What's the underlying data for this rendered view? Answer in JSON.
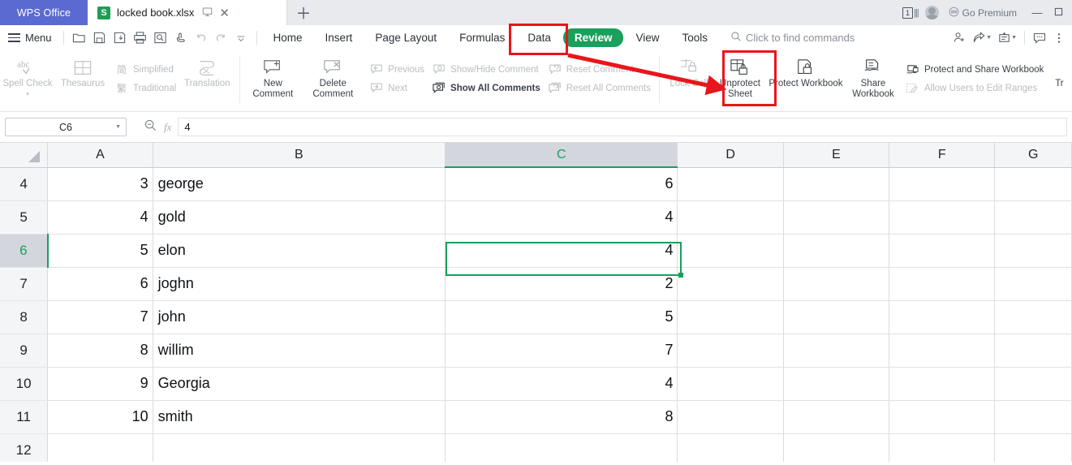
{
  "titlebar": {
    "app_tab": "WPS Office",
    "doc_tab": {
      "icon": "xlsx-icon",
      "name": "locked book.xlsx",
      "present_icon": "present-icon",
      "close_icon": "close-icon"
    },
    "new_tab_icon": "plus-icon",
    "count_badge": "1",
    "avatar": "user-avatar",
    "premium_label": "Go Premium",
    "premium_icon": "crown-icon",
    "minimize": "—",
    "maximize": "□"
  },
  "menurow": {
    "menu_label": "Menu",
    "quick_icons": [
      "open-folder-icon",
      "save-icon",
      "save-as-icon",
      "print-icon",
      "print-preview-icon",
      "touch-mode-icon",
      "undo-icon",
      "redo-icon",
      "customize-chevron-icon"
    ],
    "tabs": [
      {
        "label": "Home",
        "active": false
      },
      {
        "label": "Insert",
        "active": false
      },
      {
        "label": "Page Layout",
        "active": false
      },
      {
        "label": "Formulas",
        "active": false
      },
      {
        "label": "Data",
        "active": false
      },
      {
        "label": "Review",
        "active": true
      },
      {
        "label": "View",
        "active": false
      },
      {
        "label": "Tools",
        "active": false
      }
    ],
    "search_placeholder": "Click to find commands",
    "search_icon": "search-icon",
    "right_icons": [
      "add-person-icon",
      "share-icon",
      "coedit-icon",
      "comment-icon",
      "more-options-icon"
    ]
  },
  "ribbon": {
    "group1": {
      "spell_check": {
        "label": "Spell Check",
        "icon": "abc-spellcheck-icon",
        "disabled": true,
        "has_dropdown": true
      },
      "thesaurus": {
        "label": "Thesaurus",
        "icon": "thesaurus-icon",
        "disabled": true
      },
      "simplified": {
        "label": "Simplified",
        "icon": "simplified-chinese-icon",
        "disabled": true,
        "glyph": "简"
      },
      "traditional": {
        "label": "Traditional",
        "icon": "traditional-chinese-icon",
        "disabled": true,
        "glyph": "繁"
      },
      "translation": {
        "label": "Translation",
        "icon": "translation-icon",
        "disabled": true
      }
    },
    "group2": {
      "new_comment": {
        "label": "New\nComment",
        "line1": "New",
        "line2": "Comment",
        "icon": "new-comment-icon",
        "disabled": false
      },
      "delete_comment": {
        "label": "Delete Comment",
        "icon": "delete-comment-icon",
        "disabled": false
      },
      "previous": {
        "label": "Previous",
        "icon": "previous-comment-icon",
        "disabled": true
      },
      "next": {
        "label": "Next",
        "icon": "next-comment-icon",
        "disabled": true
      },
      "show_hide_comment": {
        "label": "Show/Hide Comment",
        "icon": "show-hide-comment-icon",
        "disabled": true
      },
      "show_all_comments": {
        "label": "Show All Comments",
        "icon": "show-all-comments-icon",
        "disabled": false
      },
      "reset_comment": {
        "label": "Reset Comment",
        "icon": "reset-comment-icon",
        "disabled": true
      },
      "reset_all_comments": {
        "label": "Reset All Comments",
        "icon": "reset-all-comments-icon",
        "disabled": true
      }
    },
    "group3": {
      "lock_cell": {
        "label": "Lock Cell",
        "icon": "lock-cell-icon",
        "disabled": true
      },
      "unprotect_sheet": {
        "line1": "Unprotect",
        "line2": "Sheet",
        "icon": "unprotect-sheet-icon",
        "disabled": false,
        "highlighted": true
      },
      "protect_workbook": {
        "label": "Protect Workbook",
        "icon": "protect-workbook-icon",
        "disabled": false
      },
      "share_workbook": {
        "line1": "Share",
        "line2": "Workbook",
        "icon": "share-workbook-icon",
        "disabled": false
      },
      "protect_and_share": {
        "label": "Protect and Share Workbook",
        "icon": "protect-share-workbook-icon",
        "disabled": false
      },
      "allow_users": {
        "label": "Allow Users to Edit Ranges",
        "icon": "allow-users-edit-ranges-icon",
        "disabled": true
      },
      "cut_off": {
        "label": "Tr"
      }
    }
  },
  "formula_bar": {
    "name_box_value": "C6",
    "name_box_caret": "chevron-down-icon",
    "zoom_icon": "zoom-out-icon",
    "fx_label": "fx",
    "formula_value": "4"
  },
  "grid": {
    "select_all_icon": "select-all-triangle-icon",
    "columns": [
      "A",
      "B",
      "C",
      "D",
      "E",
      "F",
      "G"
    ],
    "selected_column": "C",
    "selected_row": "6",
    "active_cell": "C6",
    "rows": [
      {
        "num": "4",
        "A": "3",
        "B": "george",
        "C": "6",
        "D": "",
        "E": "",
        "F": "",
        "G": ""
      },
      {
        "num": "5",
        "A": "4",
        "B": "gold",
        "C": "4",
        "D": "",
        "E": "",
        "F": "",
        "G": ""
      },
      {
        "num": "6",
        "A": "5",
        "B": "elon",
        "C": "4",
        "D": "",
        "E": "",
        "F": "",
        "G": ""
      },
      {
        "num": "7",
        "A": "6",
        "B": "joghn",
        "C": "2",
        "D": "",
        "E": "",
        "F": "",
        "G": ""
      },
      {
        "num": "8",
        "A": "7",
        "B": "john",
        "C": "5",
        "D": "",
        "E": "",
        "F": "",
        "G": ""
      },
      {
        "num": "9",
        "A": "8",
        "B": "willim",
        "C": "7",
        "D": "",
        "E": "",
        "F": "",
        "G": ""
      },
      {
        "num": "10",
        "A": "9",
        "B": "Georgia",
        "C": "4",
        "D": "",
        "E": "",
        "F": "",
        "G": ""
      },
      {
        "num": "11",
        "A": "10",
        "B": "smith",
        "C": "8",
        "D": "",
        "E": "",
        "F": "",
        "G": ""
      },
      {
        "num": "12",
        "A": "",
        "B": "",
        "C": "",
        "D": "",
        "E": "",
        "F": "",
        "G": ""
      }
    ]
  },
  "annotations": {
    "color": "#e8161b",
    "boxes": [
      "review-tab",
      "unprotect-sheet-button"
    ],
    "arrow": "review-to-unprotect-arrow"
  },
  "colors": {
    "accent_green": "#18a05c",
    "wps_blue": "#5b6ad0",
    "annotation_red": "#e8161b",
    "selection_green": "#17a05d"
  }
}
